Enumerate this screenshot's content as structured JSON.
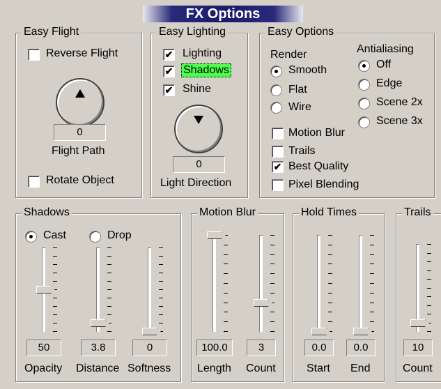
{
  "title": "FX Options",
  "easy_flight": {
    "label": "Easy Flight",
    "reverse_flight": {
      "label": "Reverse Flight",
      "checked": false
    },
    "flight_path": {
      "label": "Flight Path",
      "value": "0"
    },
    "rotate_object": {
      "label": "Rotate Object",
      "checked": false
    }
  },
  "easy_lighting": {
    "label": "Easy Lighting",
    "lighting": {
      "label": "Lighting",
      "checked": true
    },
    "shadows": {
      "label": "Shadows",
      "checked": true
    },
    "shine": {
      "label": "Shine",
      "checked": true
    },
    "light_direction": {
      "label": "Light Direction",
      "value": "0"
    }
  },
  "easy_options": {
    "label": "Easy Options",
    "render_label": "Render",
    "render": [
      "Smooth",
      "Flat",
      "Wire"
    ],
    "render_selected": "Smooth",
    "antialiasing_label": "Antialiasing",
    "antialiasing": [
      "Off",
      "Edge",
      "Scene 2x",
      "Scene 3x"
    ],
    "antialiasing_selected": "Off",
    "motion_blur": {
      "label": "Motion Blur",
      "checked": false
    },
    "trails": {
      "label": "Trails",
      "checked": false
    },
    "best_quality": {
      "label": "Best Quality",
      "checked": true
    },
    "pixel_blending": {
      "label": "Pixel Blending",
      "checked": false
    }
  },
  "shadows": {
    "label": "Shadows",
    "cast": "Cast",
    "drop": "Drop",
    "mode_selected": "Cast",
    "sliders": [
      {
        "label": "Opacity",
        "value": "50",
        "level": 0.5
      },
      {
        "label": "Distance",
        "value": "3.8",
        "level": 0.1
      },
      {
        "label": "Softness",
        "value": "0",
        "level": 0.0
      }
    ]
  },
  "motion_blur": {
    "label": "Motion Blur",
    "sliders": [
      {
        "label": "Length",
        "value": "100.0",
        "level": 1.0
      },
      {
        "label": "Count",
        "value": "3",
        "level": 0.3
      }
    ]
  },
  "hold_times": {
    "label": "Hold Times",
    "sliders": [
      {
        "label": "Start",
        "value": "0.0",
        "level": 0.0
      },
      {
        "label": "End",
        "value": "0.0",
        "level": 0.0
      }
    ]
  },
  "trails_panel": {
    "label": "Trails",
    "sliders": [
      {
        "label": "Count",
        "value": "10",
        "level": 0.1
      }
    ]
  },
  "colors": {
    "highlight": "#4cff4c",
    "title_bg": "#1a1a6a"
  }
}
